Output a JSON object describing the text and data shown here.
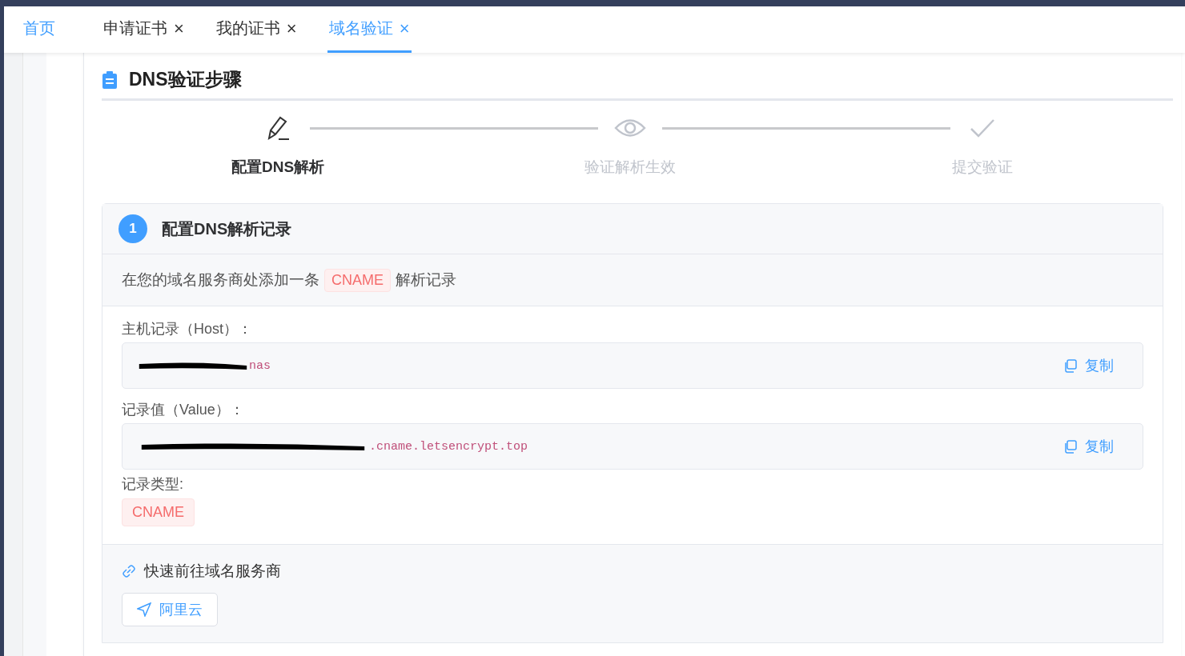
{
  "tabs": [
    {
      "label": "首页",
      "closable": false,
      "selected": false
    },
    {
      "label": "申请证书",
      "closable": true,
      "selected": false
    },
    {
      "label": "我的证书",
      "closable": true,
      "selected": false
    },
    {
      "label": "域名验证",
      "closable": true,
      "selected": true
    }
  ],
  "close_glyph": "×",
  "section_title": "DNS验证步骤",
  "steps": [
    {
      "kind": "pencil",
      "label": "配置DNS解析",
      "selected": true
    },
    {
      "kind": "eye",
      "label": "验证解析生效",
      "selected": false
    },
    {
      "kind": "check",
      "label": "提交验证",
      "selected": false
    }
  ],
  "panel": {
    "number": "1",
    "title": "配置DNS解析记录",
    "instruction_before": "在您的域名服务商处添加一条",
    "instruction_tag": "CNAME",
    "instruction_after": "解析记录",
    "fields": [
      {
        "label": "主机记录（Host）：",
        "value": "nas",
        "redacted": true,
        "copy": "复制"
      },
      {
        "label": "记录值（Value）：",
        "value": ".cname.letsencrypt.top",
        "redacted": true,
        "copy": "复制"
      }
    ],
    "type_label": "记录类型:",
    "type_tag": "CNAME",
    "quick_title": "快速前往域名服务商",
    "providers": [
      "阿里云"
    ]
  }
}
